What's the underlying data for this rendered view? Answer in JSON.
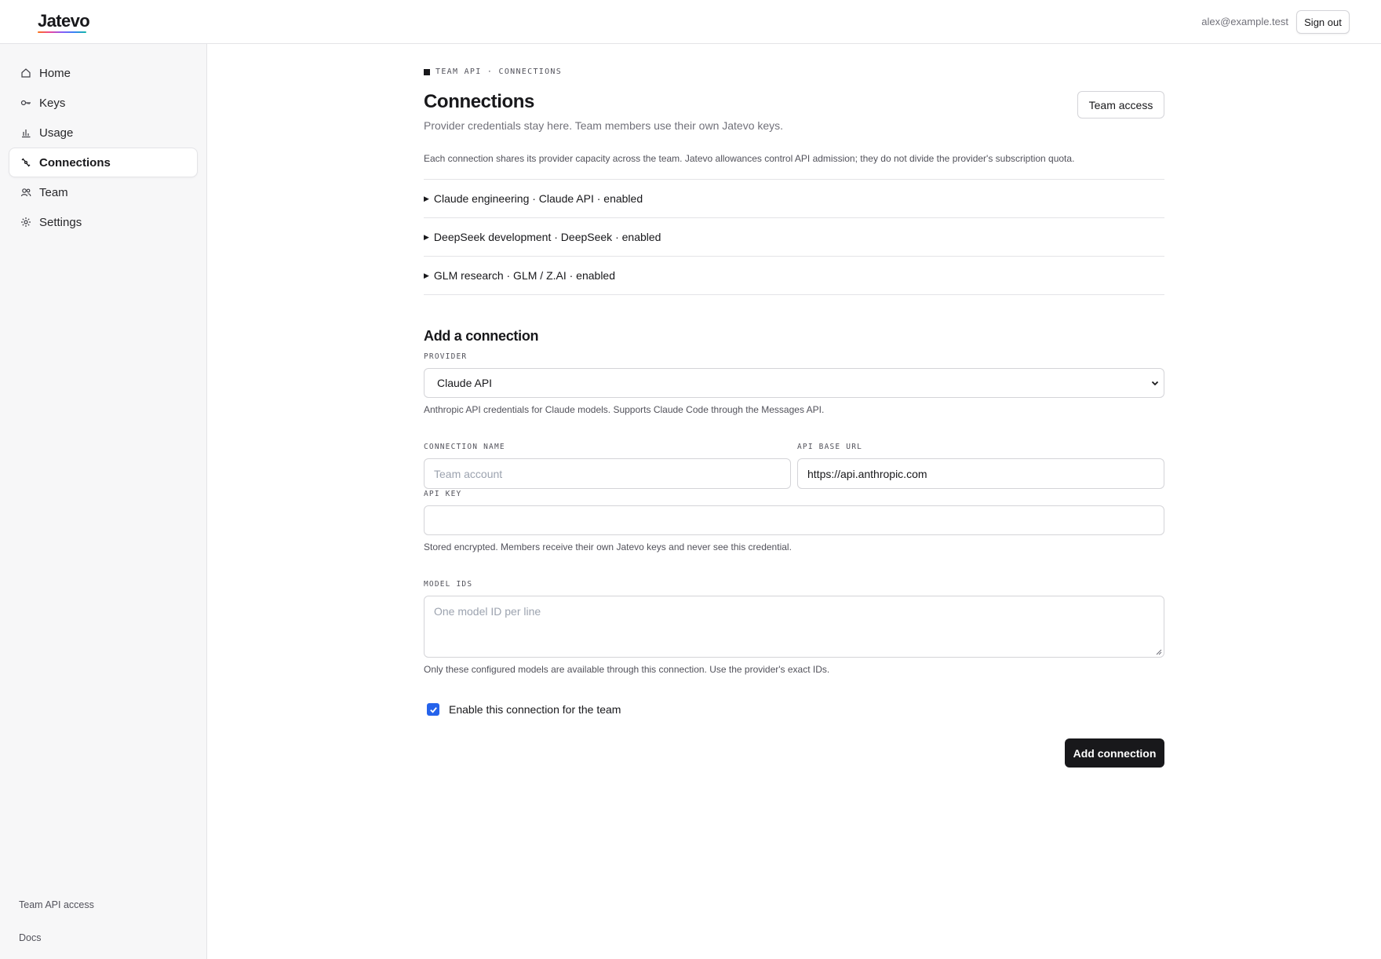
{
  "header": {
    "logo": "Jatevo",
    "user_email": "alex@example.test",
    "signout_label": "Sign out"
  },
  "sidebar": {
    "items": [
      {
        "label": "Home",
        "icon": "home-icon"
      },
      {
        "label": "Keys",
        "icon": "key-icon"
      },
      {
        "label": "Usage",
        "icon": "bar-chart-icon"
      },
      {
        "label": "Connections",
        "icon": "link-icon",
        "active": true
      },
      {
        "label": "Team",
        "icon": "users-icon"
      },
      {
        "label": "Settings",
        "icon": "gear-icon"
      }
    ],
    "footer": {
      "team_api_access": "Team API access",
      "docs": "Docs"
    }
  },
  "page": {
    "eyebrow": "TEAM API · CONNECTIONS",
    "title": "Connections",
    "subtitle": "Provider credentials stay here. Team members use their own Jatevo keys.",
    "team_access_label": "Team access",
    "note": "Each connection shares its provider capacity across the team. Jatevo allowances control API admission; they do not divide the provider's subscription quota."
  },
  "connections": [
    {
      "summary": "Claude engineering · Claude API · enabled"
    },
    {
      "summary": "DeepSeek development · DeepSeek · enabled"
    },
    {
      "summary": "GLM research · GLM / Z.AI · enabled"
    }
  ],
  "form": {
    "title": "Add a connection",
    "provider_label": "PROVIDER",
    "provider_value": "Claude API",
    "provider_help": "Anthropic API credentials for Claude models. Supports Claude Code through the Messages API.",
    "connection_name_label": "CONNECTION NAME",
    "connection_name_placeholder": "Team account",
    "api_base_url_label": "API BASE URL",
    "api_base_url_value": "https://api.anthropic.com",
    "api_key_label": "API KEY",
    "api_key_value": "",
    "api_key_help": "Stored encrypted. Members receive their own Jatevo keys and never see this credential.",
    "model_ids_label": "MODEL IDS",
    "model_ids_placeholder": "One model ID per line",
    "model_ids_help": "Only these configured models are available through this connection. Use the provider's exact IDs.",
    "enable_label": "Enable this connection for the team",
    "enable_checked": true,
    "submit_label": "Add connection"
  },
  "colors": {
    "accent": "#2563eb",
    "primary_button": "#18181b",
    "sidebar_bg": "#f7f7f8"
  }
}
